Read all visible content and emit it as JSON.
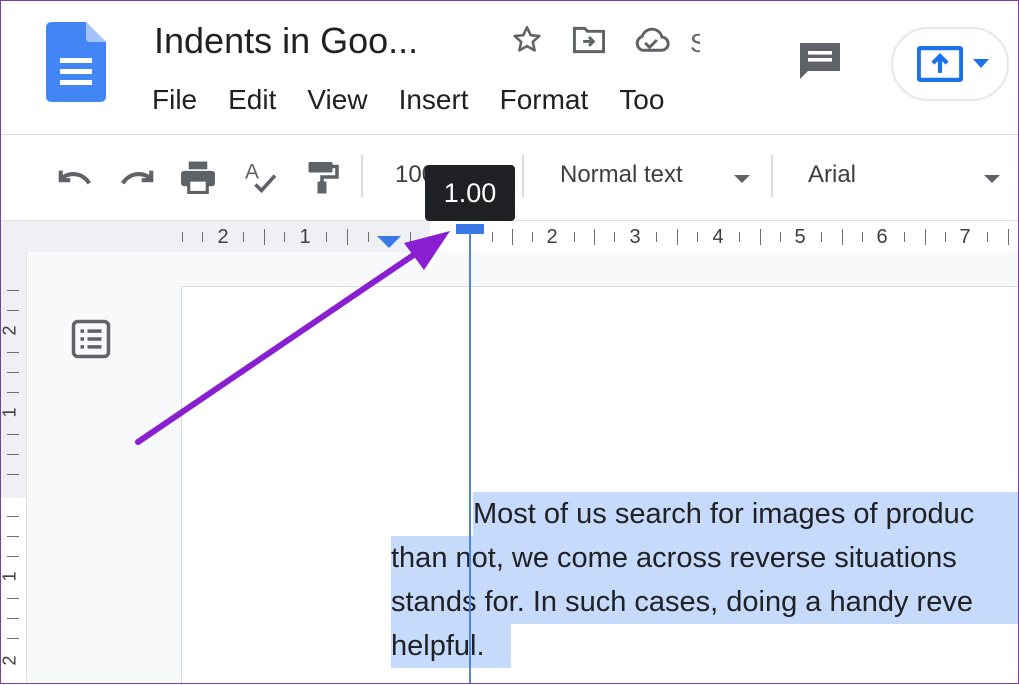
{
  "header": {
    "title": "Indents in Goo...",
    "title_clip": "S",
    "menus": [
      "File",
      "Edit",
      "View",
      "Insert",
      "Format",
      "Too"
    ]
  },
  "toolbar": {
    "zoom": "100%",
    "paragraph_style": "Normal text",
    "font": "Arial"
  },
  "tooltip": {
    "value": "1.00"
  },
  "ruler": {
    "labels_left": [
      "2",
      "1"
    ],
    "labels_right": [
      "2",
      "3",
      "4",
      "5",
      "6",
      "7"
    ]
  },
  "vertical_ruler": {
    "labels": [
      "2",
      "1",
      "1",
      "2"
    ]
  },
  "document": {
    "lines": [
      "Most of us search for images of produc",
      "than not, we come across reverse situations",
      "stands for. In such cases, doing a handy reve",
      "helpful."
    ]
  },
  "colors": {
    "accent": "#3b78e7",
    "highlight": "#c6dafc",
    "arrow": "#8a1fd1"
  }
}
